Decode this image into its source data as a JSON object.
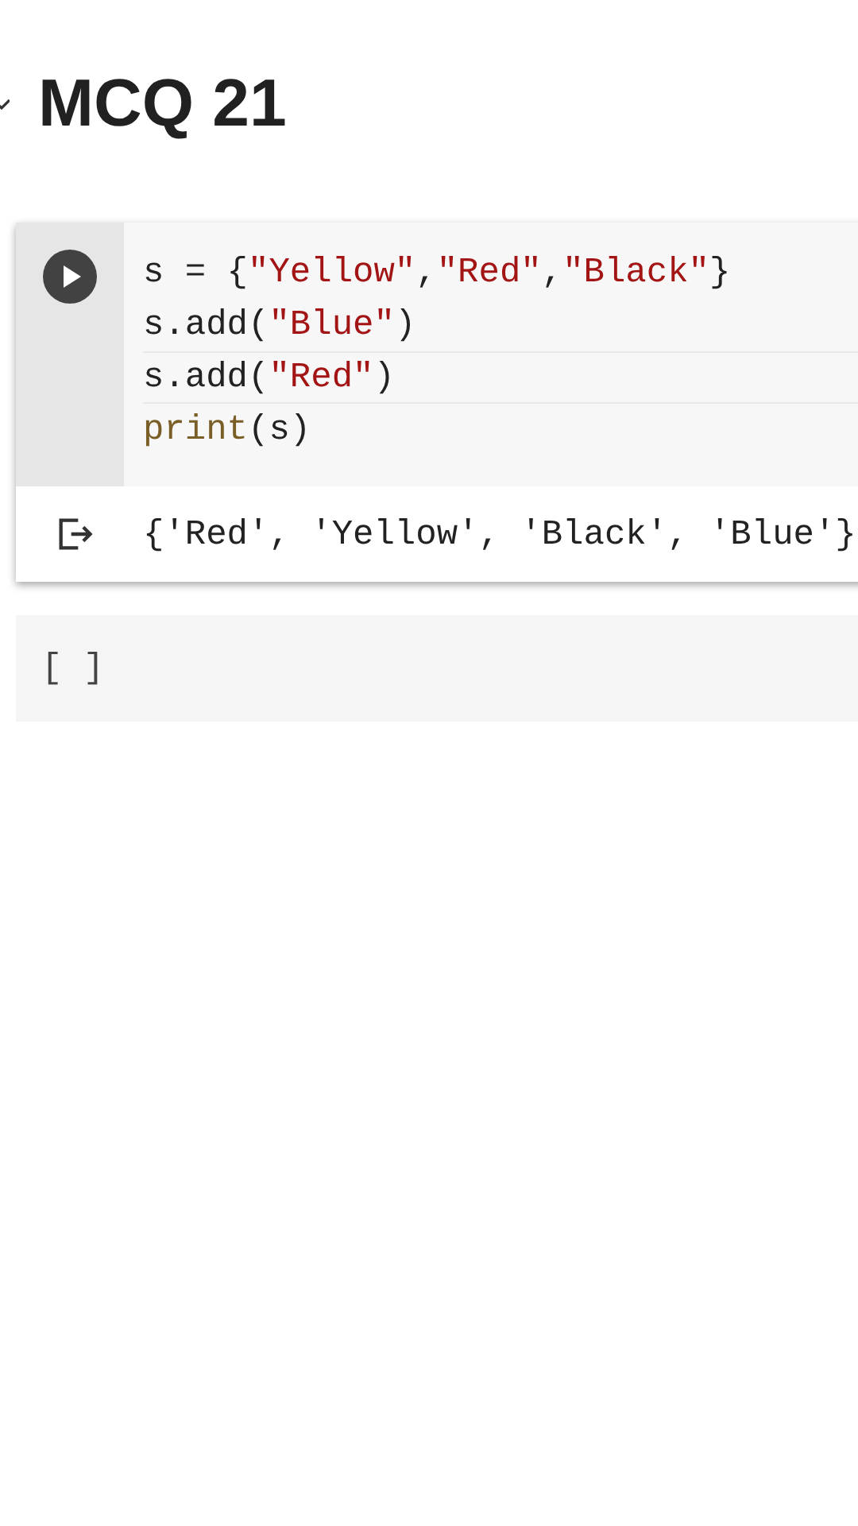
{
  "heading": {
    "title": "MCQ 21",
    "expanded": true
  },
  "code_cell": {
    "lines": [
      [
        {
          "text": "s = {",
          "kind": "plain"
        },
        {
          "text": "\"Yellow\"",
          "kind": "string"
        },
        {
          "text": ",",
          "kind": "plain"
        },
        {
          "text": "\"Red\"",
          "kind": "string"
        },
        {
          "text": ",",
          "kind": "plain"
        },
        {
          "text": "\"Black\"",
          "kind": "string"
        },
        {
          "text": "}",
          "kind": "plain"
        }
      ],
      [
        {
          "text": "s.add(",
          "kind": "plain"
        },
        {
          "text": "\"Blue\"",
          "kind": "string"
        },
        {
          "text": ")",
          "kind": "plain"
        }
      ],
      [
        {
          "text": "s.add(",
          "kind": "plain"
        },
        {
          "text": "\"Red\"",
          "kind": "string"
        },
        {
          "text": ")",
          "kind": "plain"
        }
      ],
      [
        {
          "text": "print",
          "kind": "builtin"
        },
        {
          "text": "(s)",
          "kind": "plain"
        }
      ]
    ],
    "output": "{'Red', 'Yellow', 'Black', 'Blue'}"
  },
  "empty_cell": {
    "prompt": "[ ]"
  }
}
